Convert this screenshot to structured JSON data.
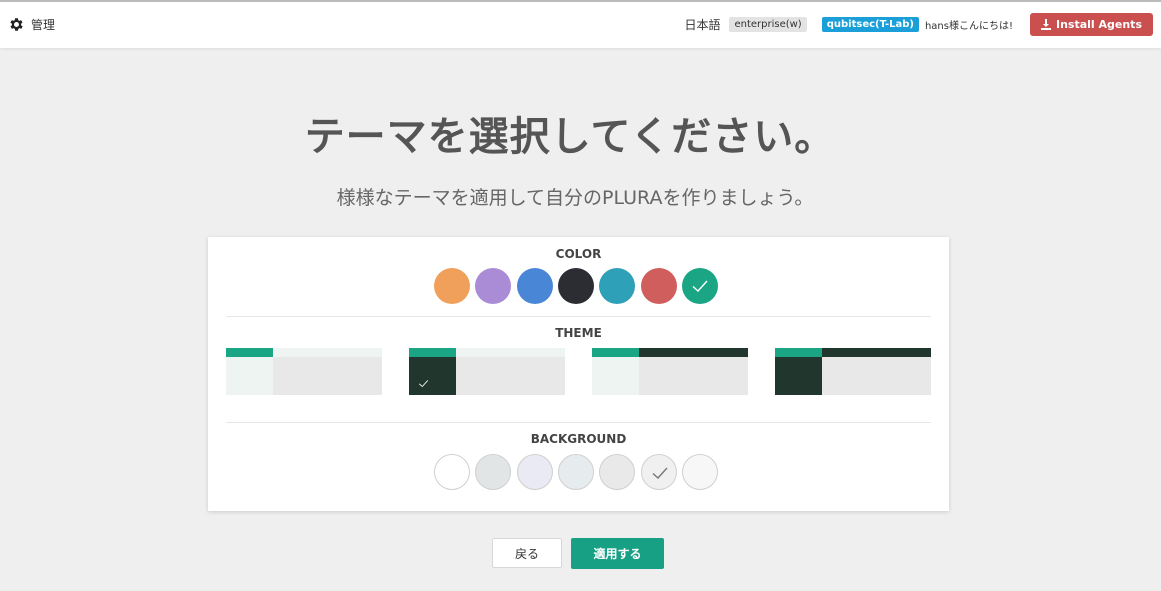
{
  "header": {
    "admin_label": "管理",
    "language": "日本語",
    "plan_badge": "enterprise(w)",
    "org_badge": "qubitsec(T-Lab)",
    "greeting": "hans様こんにちは!",
    "install_label": "Install Agents"
  },
  "main": {
    "title": "テーマを選択してください。",
    "subtitle": "様様なテーマを適用して自分のPLURAを作りましょう。"
  },
  "sections": {
    "color_label": "COLOR",
    "theme_label": "THEME",
    "background_label": "BACKGROUND"
  },
  "colors": [
    {
      "name": "orange",
      "hex": "#f0a05a"
    },
    {
      "name": "purple",
      "hex": "#a98bd6"
    },
    {
      "name": "blue",
      "hex": "#4a86d6"
    },
    {
      "name": "dark",
      "hex": "#2b2d32"
    },
    {
      "name": "teal",
      "hex": "#2ea0b7"
    },
    {
      "name": "red",
      "hex": "#d05e5d"
    },
    {
      "name": "green",
      "hex": "#1aa584",
      "selected": true
    }
  ],
  "themes": [
    {
      "top_left": "#1aa584",
      "top_right": "#eef4f1",
      "side": "#eef4f1",
      "selected": false
    },
    {
      "top_left": "#1aa584",
      "top_right": "#eef4f1",
      "side": "#21362c",
      "selected": true
    },
    {
      "top_left": "#1aa584",
      "top_right": "#21362c",
      "side": "#eef4f1",
      "selected": false
    },
    {
      "top_left": "#1aa584",
      "top_right": "#21362c",
      "side": "#21362c",
      "selected": false
    }
  ],
  "backgrounds": [
    {
      "hex": "#ffffff"
    },
    {
      "hex": "#e2e5e6"
    },
    {
      "hex": "#e9eaf4"
    },
    {
      "hex": "#e6ebee"
    },
    {
      "hex": "#e9e9e9"
    },
    {
      "hex": "#f0f0f0",
      "selected": true
    },
    {
      "hex": "#f7f7f7"
    }
  ],
  "buttons": {
    "back_label": "戻る",
    "apply_label": "適用する"
  }
}
